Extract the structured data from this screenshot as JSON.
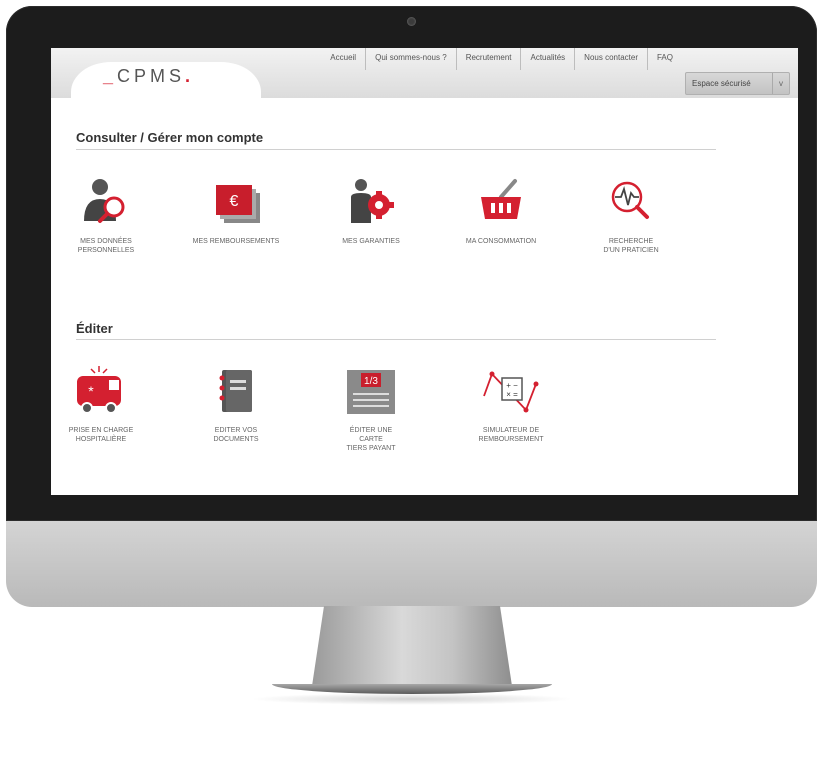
{
  "brand": {
    "logo_text": "CPMS",
    "accent_color": "#d42030"
  },
  "nav": {
    "items": [
      "Accueil",
      "Qui sommes-nous ?",
      "Recrutement",
      "Actualités",
      "Nous contacter",
      "FAQ"
    ]
  },
  "espace": {
    "label": "Espace sécurisé"
  },
  "sections": {
    "consulter": {
      "title": "Consulter / Gérer mon compte",
      "tiles": [
        {
          "label": "MES DONNÉES\nPERSONNELLES",
          "icon": "person-search-icon"
        },
        {
          "label": "MES REMBOURSEMENTS",
          "icon": "euro-cards-icon"
        },
        {
          "label": "MES GARANTIES",
          "icon": "person-gear-icon"
        },
        {
          "label": "MA CONSOMMATION",
          "icon": "basket-icon"
        },
        {
          "label": "RECHERCHE\nD'UN PRATICIEN",
          "icon": "heartbeat-search-icon"
        }
      ]
    },
    "editer": {
      "title": "Éditer",
      "tiles": [
        {
          "label": "PRISE EN CHARGE\nHOSPITALIÈRE",
          "icon": "ambulance-icon"
        },
        {
          "label": "EDITER VOS\nDOCUMENTS",
          "icon": "notebook-icon"
        },
        {
          "label": "ÉDITER UNE\nCARTE\nTIERS PAYANT",
          "icon": "card-icon"
        },
        {
          "label": "SIMULATEUR DE\nREMBOURSEMENT",
          "icon": "calculator-chart-icon"
        }
      ],
      "card_fraction": "1/3"
    }
  }
}
